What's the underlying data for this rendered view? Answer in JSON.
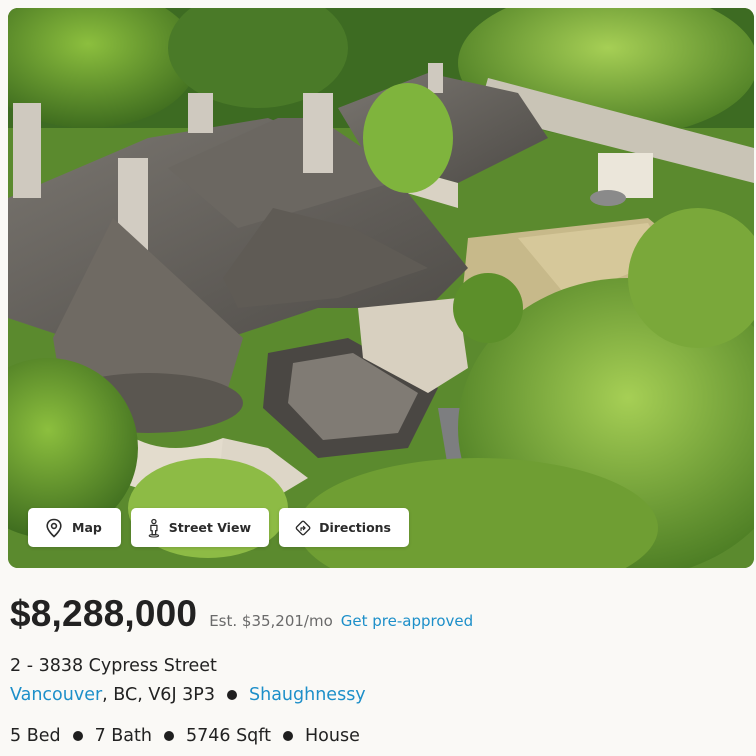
{
  "photo": {
    "alt_subject": "aerial-house-photo",
    "actions": [
      {
        "label": "Map",
        "icon": "map-pin-icon"
      },
      {
        "label": "Street View",
        "icon": "person-icon"
      },
      {
        "label": "Directions",
        "icon": "directions-icon"
      }
    ]
  },
  "listing": {
    "price": "$8,288,000",
    "estimate": "Est. $35,201/mo",
    "preapproved_link": "Get pre-approved",
    "address": "2 - 3838 Cypress Street",
    "city": "Vancouver",
    "region_postal": ", BC, V6J 3P3",
    "neighbourhood": "Shaughnessy",
    "specs": [
      "5 Bed",
      "7 Bath",
      "5746 Sqft",
      "House"
    ]
  },
  "colors": {
    "link": "#1d8fc9",
    "text": "#222222",
    "muted": "#6a6a6a",
    "background": "#faf9f6"
  }
}
